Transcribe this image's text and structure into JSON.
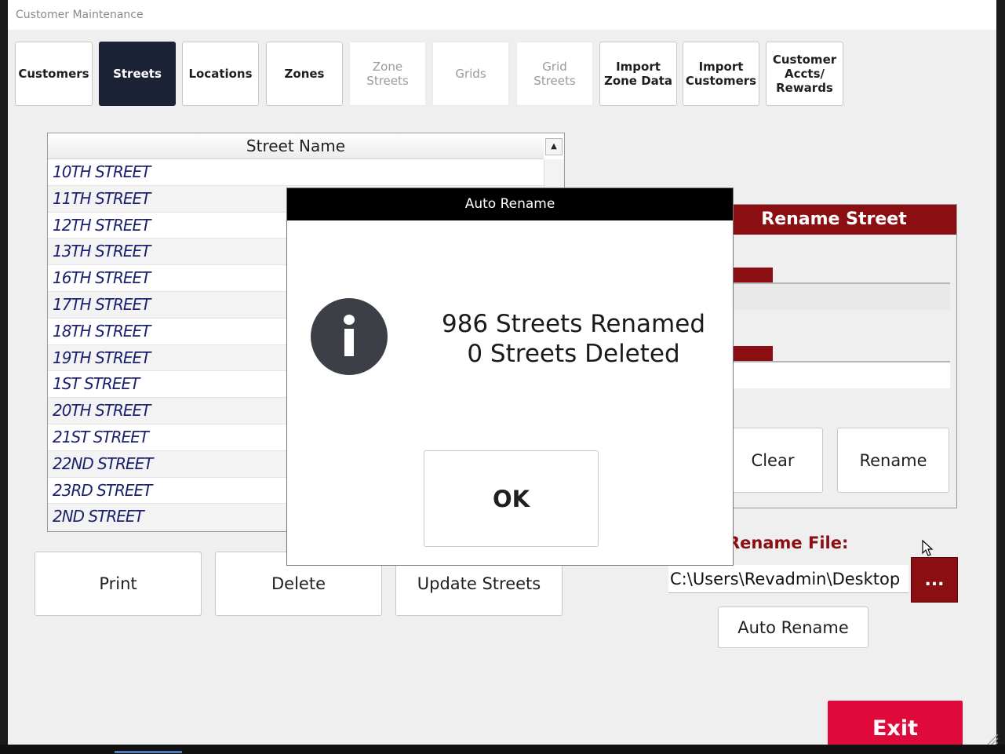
{
  "window": {
    "title": "Customer Maintenance"
  },
  "tabs": [
    {
      "label": "Customers",
      "state": "normal"
    },
    {
      "label": "Streets",
      "state": "active"
    },
    {
      "label": "Locations",
      "state": "normal"
    },
    {
      "label": "Zones",
      "state": "normal"
    },
    {
      "label": "Zone\nStreets",
      "state": "disabled"
    },
    {
      "label": "Grids",
      "state": "disabled"
    },
    {
      "label": "Grid\nStreets",
      "state": "disabled"
    },
    {
      "label": "Import\nZone Data",
      "state": "normal"
    },
    {
      "label": "Import\nCustomers",
      "state": "normal"
    },
    {
      "label": "Customer\nAccts/\nRewards",
      "state": "normal"
    }
  ],
  "street_list": {
    "header": "Street Name",
    "scroll_up_icon": "▲",
    "rows": [
      "10TH STREET",
      "11TH STREET",
      "12TH STREET",
      "13TH STREET",
      "16TH STREET",
      "17TH STREET",
      "18TH STREET",
      "19TH STREET",
      "1ST STREET",
      "20TH STREET",
      "21ST STREET",
      "22ND STREET",
      "23RD STREET",
      "2ND STREET"
    ]
  },
  "actions": {
    "print_label": "Print",
    "delete_label": "Delete",
    "update_label": "Update Streets"
  },
  "rename_panel": {
    "title": "Rename Street",
    "clear_label": "Clear",
    "rename_label": "Rename"
  },
  "rename_file": {
    "label": "Rename File:",
    "path": "C:\\Users\\Revadmin\\Desktop",
    "browse_label": "...",
    "auto_rename_label": "Auto Rename"
  },
  "exit_label": "Exit",
  "dialog": {
    "title": "Auto Rename",
    "icon": "info-icon",
    "line1": "986 Streets Renamed",
    "line2": "0 Streets Deleted",
    "ok_label": "OK"
  },
  "colors": {
    "active_tab": "#1b2235",
    "accent_red": "#8b0e12",
    "exit_red": "#e00a3a",
    "street_text": "#1a1f6e"
  }
}
